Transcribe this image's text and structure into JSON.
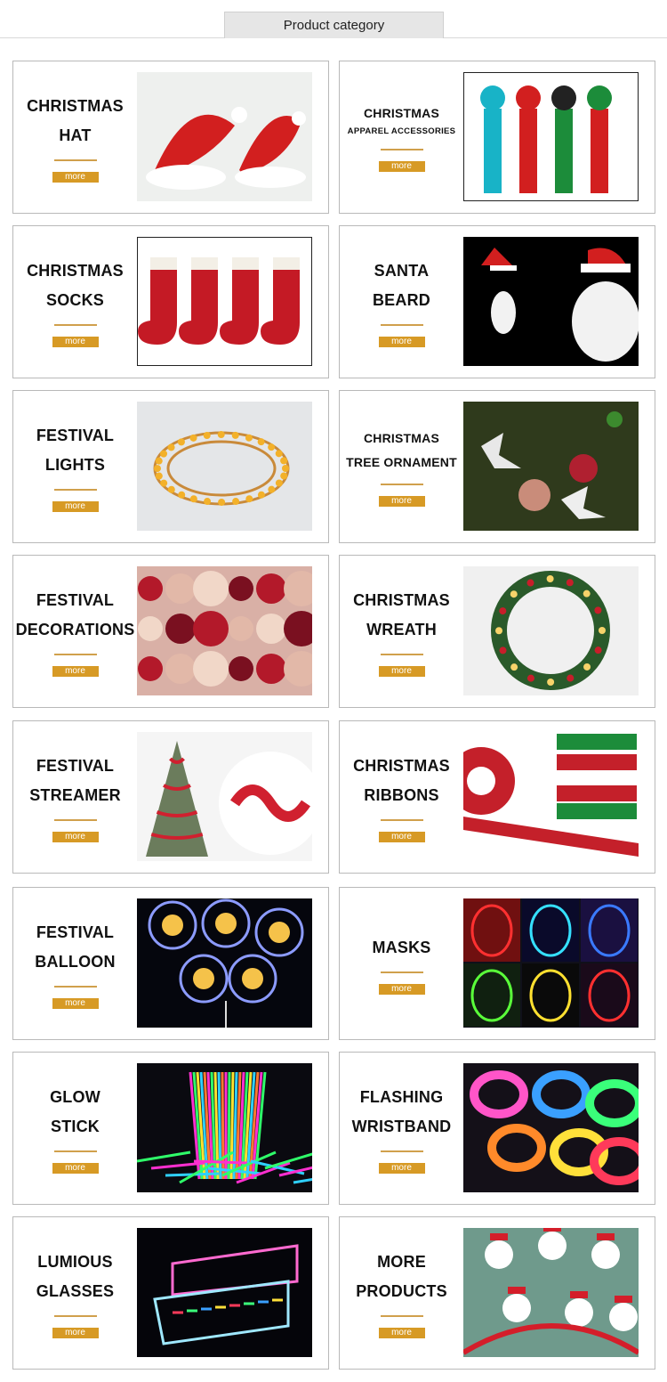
{
  "header": {
    "title": "Product category"
  },
  "more_label": "more",
  "cards": [
    {
      "line1": "CHRISTMAS",
      "line2": "HAT",
      "image": "christmas-hats-photo",
      "bg": "#eef0ee",
      "accent": "#d21f1f"
    },
    {
      "line1": "CHRISTMAS",
      "line2": "APPAREL ACCESSORIES",
      "image": "knit-hats-scarves-photo",
      "bg": "#ffffff",
      "accent": "#18b3c7",
      "small": true,
      "framed": true
    },
    {
      "line1": "CHRISTMAS",
      "line2": "SOCKS",
      "image": "christmas-stockings-photo",
      "bg": "#ffffff",
      "accent": "#c41a25",
      "framed": true
    },
    {
      "line1": "SANTA",
      "line2": "BEARD",
      "image": "santa-beard-photo",
      "bg": "#000000",
      "accent": "#f2f2f2"
    },
    {
      "line1": "FESTIVAL",
      "line2": "LIGHTS",
      "image": "fairy-lights-photo",
      "bg": "#e4e6e8",
      "accent": "#f3b12a"
    },
    {
      "line1": "CHRISTMAS",
      "line2": "TREE ORNAMENT",
      "image": "tree-ornament-photo",
      "bg": "#2f3a1c",
      "accent": "#c9c1b5",
      "small2": true
    },
    {
      "line1": "FESTIVAL",
      "line2": "DECORATIONS",
      "image": "decoration-balls-photo",
      "bg": "#d9b0a6",
      "accent": "#b3192a"
    },
    {
      "line1": "CHRISTMAS",
      "line2": "WREATH",
      "image": "wreath-photo",
      "bg": "#f0f0f0",
      "accent": "#2a5a2a"
    },
    {
      "line1": "FESTIVAL",
      "line2": "STREAMER",
      "image": "tinsel-streamer-photo",
      "bg": "#f5f5f5",
      "accent": "#d0202f"
    },
    {
      "line1": "CHRISTMAS",
      "line2": "RIBBONS",
      "image": "christmas-ribbons-photo",
      "bg": "#ffffff",
      "accent": "#c4202a"
    },
    {
      "line1": "FESTIVAL",
      "line2": "BALLOON",
      "image": "led-balloons-photo",
      "bg": "#05060d",
      "accent": "#8c9bff"
    },
    {
      "line1": "",
      "line2": "MASKS",
      "image": "led-masks-photo",
      "bg": "#10101a",
      "accent": "#35e0ff"
    },
    {
      "line1": "GLOW",
      "line2": "STICK",
      "image": "glow-sticks-photo",
      "bg": "#0a0a10",
      "accent": "#ff2fd0"
    },
    {
      "line1": "FLASHING",
      "line2": "WRISTBAND",
      "image": "led-wristbands-photo",
      "bg": "#141018",
      "accent": "#ff55c8"
    },
    {
      "line1": "LUMIOUS",
      "line2": "GLASSES",
      "image": "led-glasses-photo",
      "bg": "#05050a",
      "accent": "#9fe8ff"
    },
    {
      "line1": "MORE",
      "line2": "PRODUCTS",
      "image": "headbands-photo",
      "bg": "#6f9a8c",
      "accent": "#d41e2a"
    }
  ]
}
